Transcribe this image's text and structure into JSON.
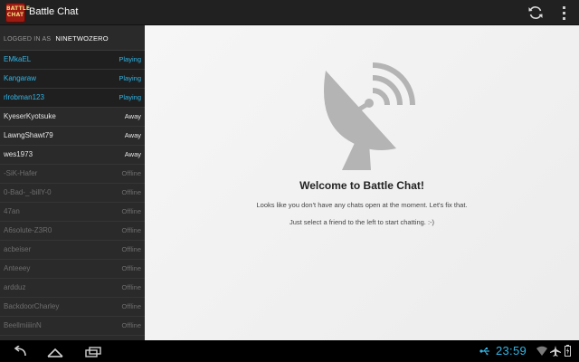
{
  "app": {
    "icon_text_line1": "BATTLE",
    "icon_text_line2": "CHAT",
    "title": "Battle Chat"
  },
  "sidebar": {
    "logged_in_label": "LOGGED IN AS",
    "username": "NINETWOZERO",
    "friends": [
      {
        "name": "EMkaEL",
        "status": "Playing"
      },
      {
        "name": "Kangaraw",
        "status": "Playing"
      },
      {
        "name": "rlrobman123",
        "status": "Playing"
      },
      {
        "name": "KyeserKyotsuke",
        "status": "Away"
      },
      {
        "name": "LawngShawt79",
        "status": "Away"
      },
      {
        "name": "wes1973",
        "status": "Away"
      },
      {
        "name": "-SiK-Hafer",
        "status": "Offline"
      },
      {
        "name": "0-Bad-_-billY-0",
        "status": "Offline"
      },
      {
        "name": "47an",
        "status": "Offline"
      },
      {
        "name": "A6solute-Z3R0",
        "status": "Offline"
      },
      {
        "name": "acbeiser",
        "status": "Offline"
      },
      {
        "name": "Anteeey",
        "status": "Offline"
      },
      {
        "name": "ardduz",
        "status": "Offline"
      },
      {
        "name": "BackdoorCharley",
        "status": "Offline"
      },
      {
        "name": "BeellmiiiinN",
        "status": "Offline"
      }
    ]
  },
  "main": {
    "icon": "satellite-dish-icon",
    "title": "Welcome to Battle Chat!",
    "line1": "Looks like you don't have any chats open at the moment. Let's fix that.",
    "line2": "Just select a friend to the left to start chatting. :-)"
  },
  "statusbar": {
    "clock": "23:59"
  },
  "colors": {
    "accent": "#33b5e5",
    "actionbar": "#212121",
    "sidebar": "#2a2a2a",
    "icon_red": "#9b1b12"
  }
}
